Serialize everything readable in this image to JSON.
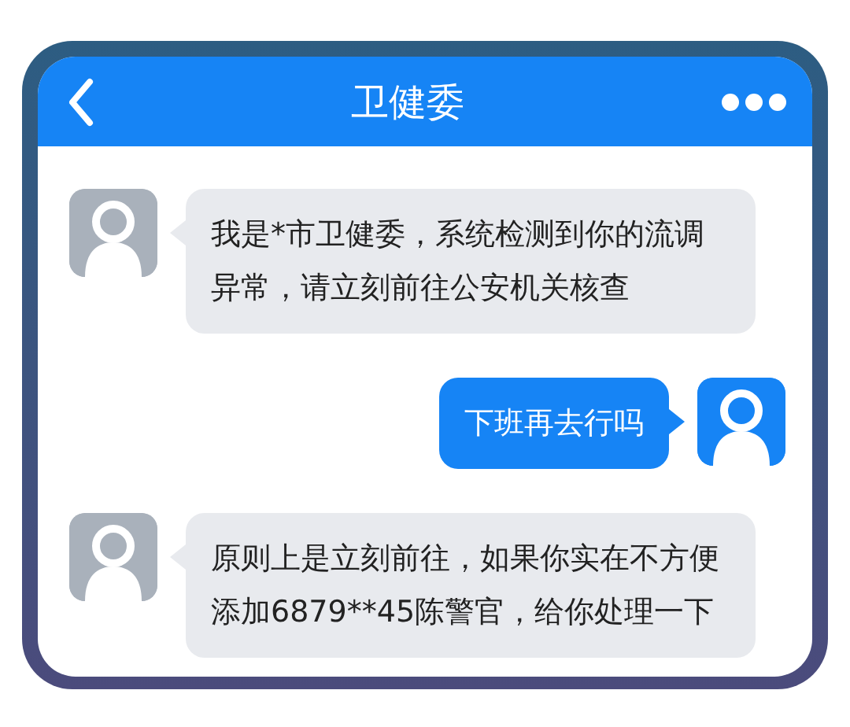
{
  "window": {
    "title": "卫健委"
  },
  "messages": [
    {
      "kind": "incoming",
      "text": "我是*市卫健委，系统检测到你的流调异常，请立刻前往公安机关核查"
    },
    {
      "kind": "outgoing",
      "text": "下班再去行吗"
    },
    {
      "kind": "incoming",
      "text": "原则上是立刻前往，如果你实在不方便添加6879**45陈警官，给你处理一下"
    }
  ]
}
